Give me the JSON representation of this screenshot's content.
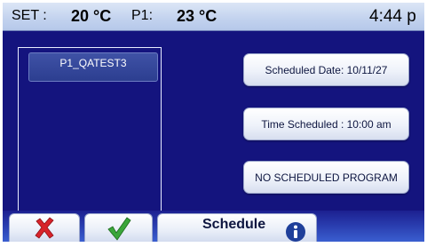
{
  "status_bar": {
    "set_label": "SET :",
    "set_value": "20 °C",
    "p1_label": "P1:",
    "p1_value": "23 °C",
    "clock": "4:44 p"
  },
  "program_list": {
    "items": [
      {
        "label": "P1_QATEST3"
      }
    ]
  },
  "schedule_info": {
    "date_label": "Scheduled Date: 10/11/27",
    "time_label": "Time Scheduled : 10:00 am",
    "program_label": "NO SCHEDULED PROGRAM"
  },
  "bottom_bar": {
    "cancel_icon": "red-x-icon",
    "confirm_icon": "green-check-icon",
    "tab_label": "Schedule",
    "info_icon": "info-icon"
  },
  "colors": {
    "background": "#14147e",
    "cancel": "#d8232a",
    "confirm": "#3aa63a",
    "info": "#1f3f9a"
  }
}
